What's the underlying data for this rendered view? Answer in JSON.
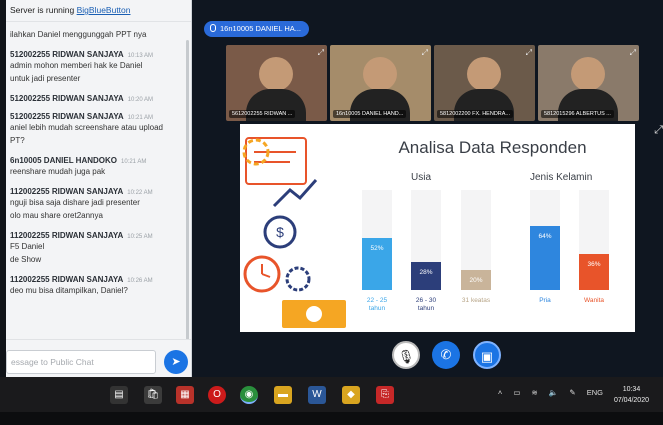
{
  "chat": {
    "notice_prefix": "Server is running ",
    "notice_link": "BigBlueButton",
    "messages": [
      {
        "lines": [
          "ilahkan Daniel menggunggah PPT nya"
        ]
      },
      {
        "sender": "512002255 RIDWAN SANJAYA",
        "time": "10:13 AM",
        "lines": [
          "admin mohon memberi hak ke Daniel",
          "untuk jadi presenter"
        ]
      },
      {
        "sender": "512002255 RIDWAN SANJAYA",
        "time": "10:20 AM",
        "lines": []
      },
      {
        "sender": "512002255 RIDWAN SANJAYA",
        "time": "10:21 AM",
        "lines": [
          "aniel lebih mudah screenshare atau upload",
          "PT?"
        ]
      },
      {
        "sender": "6n10005 DANIEL HANDOKO",
        "time": "10:21 AM",
        "lines": [
          "reenshare mudah juga pak"
        ]
      },
      {
        "sender": "112002255 RIDWAN SANJAYA",
        "time": "10:22 AM",
        "lines": [
          "nguji bisa saja dishare jadi presenter",
          "olo mau share oret2annya"
        ]
      },
      {
        "sender": "112002255 RIDWAN SANJAYA",
        "time": "10:25 AM",
        "lines": [
          "F5 Daniel",
          "de Show"
        ]
      },
      {
        "sender": "112002255 RIDWAN SANJAYA",
        "time": "10:26 AM",
        "lines": [
          "deo mu bisa ditampilkan, Daniel?"
        ]
      }
    ],
    "input_placeholder": "essage to Public Chat",
    "send_icon": "send-arrow-icon"
  },
  "presenter": {
    "badge": "16n10005 DANIEL HA..."
  },
  "videos": [
    {
      "name": "5612002255 RIDWAN ...",
      "bg": "#7a5a48"
    },
    {
      "name": "16n10005 DANIEL HAND...",
      "bg": "#a58c6a"
    },
    {
      "name": "5812002200 FX. HENDRA...",
      "bg": "#6b5a4a"
    },
    {
      "name": "5812015296 ALBERTUS ...",
      "bg": "#8a7a6a"
    }
  ],
  "slide": {
    "title": "Analisa Data Responden"
  },
  "chart_data": {
    "type": "bar",
    "groups": [
      {
        "label": "Usia",
        "categories": [
          "22 - 25 tahun",
          "26 - 30 tahun",
          "31 keatas"
        ],
        "values": [
          52,
          28,
          20
        ],
        "colors": [
          "#3aa6e8",
          "#2c3e7a",
          "#c9b49a"
        ]
      },
      {
        "label": "Jenis Kelamin",
        "categories": [
          "Pria",
          "Wanita"
        ],
        "values": [
          64,
          36
        ],
        "colors": [
          "#2e86de",
          "#e8542a"
        ]
      }
    ],
    "value_labels": [
      "52%",
      "28%",
      "20%",
      "64%",
      "36%"
    ],
    "ylim": [
      0,
      100
    ]
  },
  "controls": {
    "mic_icon": "mic-muted-icon",
    "phone_icon": "phone-icon",
    "camera_icon": "camera-icon"
  },
  "taskbar": {
    "lang": "ENG",
    "time": "10:34",
    "date": "07/04/2020"
  }
}
